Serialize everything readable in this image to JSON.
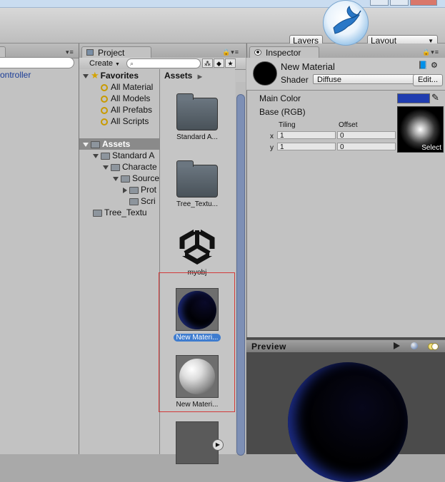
{
  "toolbar": {
    "layers_label": "Layers",
    "layout_label": "Layout"
  },
  "hierarchy": {
    "item_label": "ontroller"
  },
  "project": {
    "tab_label": "Project",
    "create_label": "Create",
    "favorites": {
      "title": "Favorites",
      "items": [
        "All Material",
        "All Models",
        "All Prefabs",
        "All Scripts"
      ]
    },
    "tree": {
      "root": "Assets",
      "items": [
        "Standard A",
        "Characte",
        "Source",
        "Prot",
        "Scri",
        "Tree_Textu"
      ]
    },
    "grid": {
      "header": "Assets",
      "items": [
        "Standard A...",
        "Tree_Textu...",
        "myobj",
        "New Materi...",
        "New Materi..."
      ]
    }
  },
  "inspector": {
    "tab_label": "Inspector",
    "material_name": "New Material",
    "shader_label": "Shader",
    "shader_value": "Diffuse",
    "edit_label": "Edit...",
    "main_color_label": "Main Color",
    "main_color": "#203db0",
    "base_label": "Base (RGB)",
    "tiling_label": "Tiling",
    "offset_label": "Offset",
    "x_label": "x",
    "y_label": "y",
    "tiling_x": "1",
    "tiling_y": "1",
    "offset_x": "0",
    "offset_y": "0",
    "select_label": "Select"
  },
  "preview": {
    "title": "Preview"
  },
  "colors": {
    "selection": "#3e7ccf",
    "scrollbar": "#7d8fb5",
    "highlight_box": "#d23a3a"
  }
}
